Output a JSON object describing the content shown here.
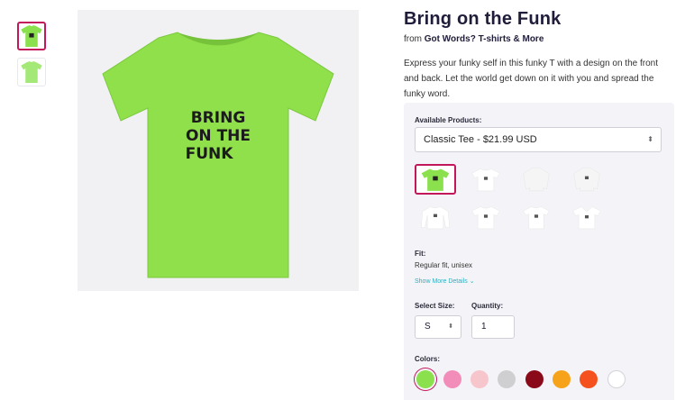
{
  "product": {
    "title": "Bring on the Funk",
    "from_prefix": "from",
    "store": "Got Words? T-shirts & More",
    "description": "Express your funky self in this funky T with a design on the front and back. Let the world get down on it with you and spread the funky word.",
    "shirt_text": [
      "BRING",
      "ON THE",
      "FUNK"
    ]
  },
  "options": {
    "available_label": "Available Products:",
    "selected_product": "Classic Tee - $21.99 USD",
    "fit_label": "Fit:",
    "fit_value": "Regular fit, unisex",
    "show_more": "Show More Details",
    "size_label": "Select Size:",
    "size_value": "S",
    "qty_label": "Quantity:",
    "qty_value": "1",
    "colors_label": "Colors:"
  },
  "colors": {
    "accent": "#c2185b",
    "link": "#2ab0c0",
    "swatches": [
      "#8be04e",
      "#f28cb8",
      "#f7c6cc",
      "#cfcfd2",
      "#8b0a1a",
      "#f7a21b",
      "#f4511e",
      "#ffffff"
    ]
  }
}
